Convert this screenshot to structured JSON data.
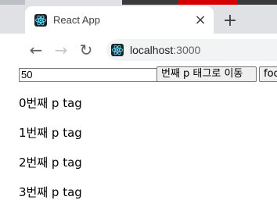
{
  "browser": {
    "tab": {
      "title": "React App",
      "close_label": "×"
    },
    "new_tab_label": "+",
    "toolbar": {
      "back_label": "←",
      "forward_label": "→",
      "reload_label": "↻",
      "url_host": "localhost",
      "url_port": ":3000"
    }
  },
  "page": {
    "input_value": "50",
    "move_button_label": "번째 p 태그로 이동",
    "focus_button_label": "focus",
    "paragraphs": [
      "0번째 p tag",
      "1번째 p tag",
      "2번째 p tag",
      "3번째 p tag"
    ]
  },
  "colors": {
    "react_logo": "#61dafb",
    "favicon_bg": "#20232a"
  }
}
